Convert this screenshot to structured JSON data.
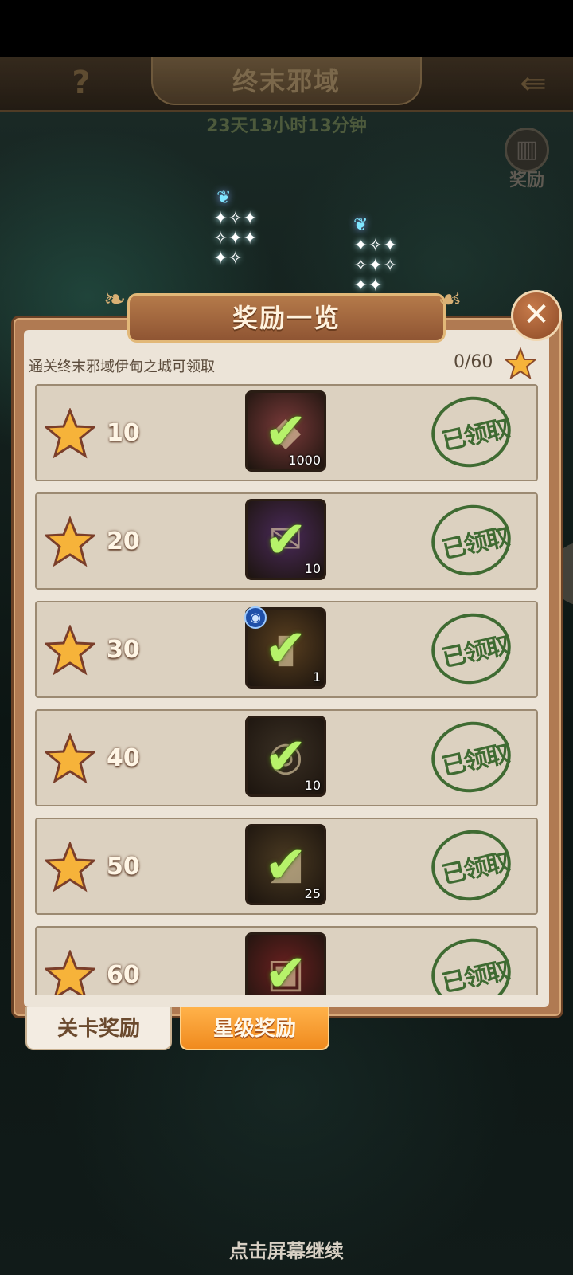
{
  "header": {
    "help_label": "?",
    "title": "终末邪域",
    "back_label": "⇚"
  },
  "timer": "23天13小时13分钟",
  "reward_button": {
    "icon": "book-icon",
    "label": "奖励"
  },
  "panel": {
    "title": "奖励一览",
    "subtitle": "通关终末邪域伊甸之城可领取",
    "progress": "0/60",
    "close_label": "✕"
  },
  "rewards": [
    {
      "stars": "10",
      "item": "gem-crystal",
      "qty": "1000",
      "status": "已领取",
      "color": "#7a3a3a"
    },
    {
      "stars": "20",
      "item": "scroll",
      "qty": "10",
      "status": "已领取",
      "color": "#4a2a5a"
    },
    {
      "stars": "30",
      "item": "card",
      "qty": "1",
      "status": "已领取",
      "color": "#5a4020"
    },
    {
      "stars": "40",
      "item": "orb",
      "qty": "10",
      "status": "已领取",
      "color": "#3a3024"
    },
    {
      "stars": "50",
      "item": "shard",
      "qty": "25",
      "status": "已领取",
      "color": "#4a3a22"
    },
    {
      "stars": "60",
      "item": "chest",
      "qty": "",
      "status": "已领取",
      "color": "#6a2020"
    }
  ],
  "tabs": {
    "level": "关卡奖励",
    "star": "星级奖励"
  },
  "continue_hint": "点击屏幕继续",
  "colors": {
    "accent": "#f08a1e",
    "stamp": "#3f6b32",
    "check": "#b6f26a",
    "star": "#f6b33a"
  }
}
